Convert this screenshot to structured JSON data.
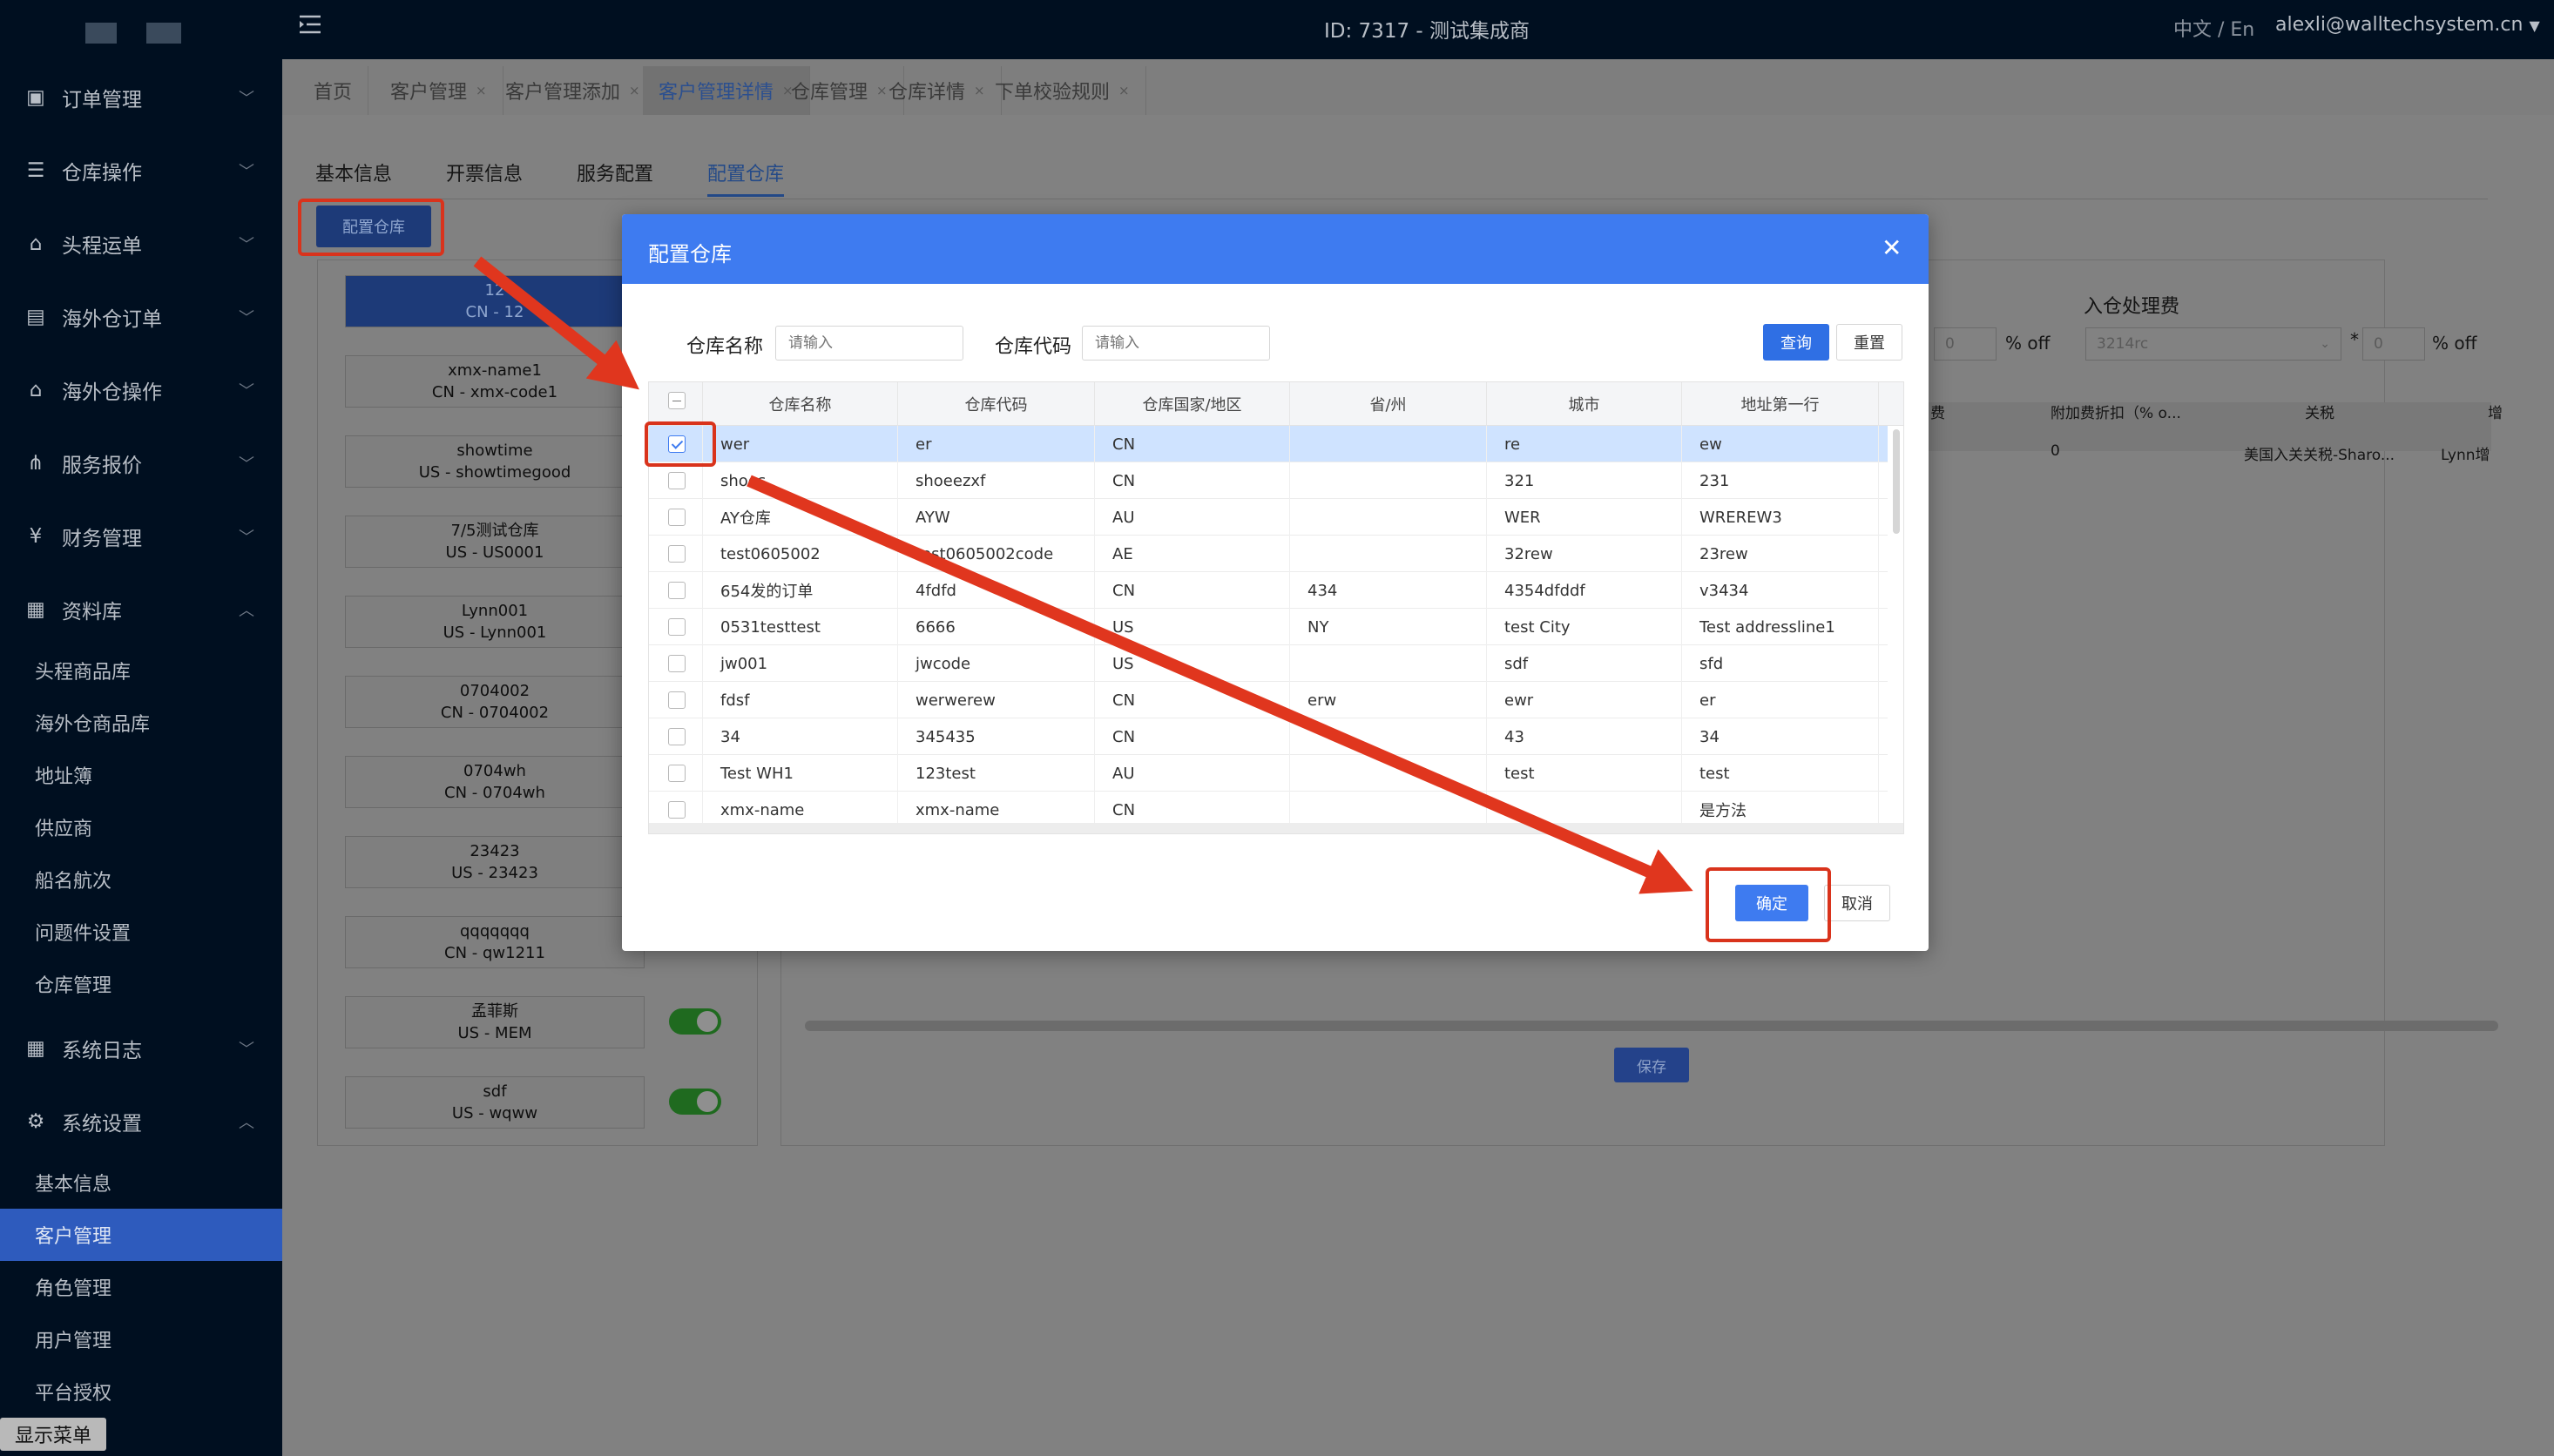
{
  "topbar": {
    "title": "ID: 7317 - 测试集成商",
    "lang": "中文 / En",
    "user": "alexli@walltechsystem.cn"
  },
  "sidebar": {
    "items": [
      {
        "label": "订单管理",
        "icon": "clipboard-icon"
      },
      {
        "label": "仓库操作",
        "icon": "warehouse-icon"
      },
      {
        "label": "头程运单",
        "icon": "package-icon"
      },
      {
        "label": "海外仓订单",
        "icon": "document-icon"
      },
      {
        "label": "海外仓操作",
        "icon": "home-icon"
      },
      {
        "label": "服务报价",
        "icon": "share-icon"
      },
      {
        "label": "财务管理",
        "icon": "yen-icon"
      },
      {
        "label": "资料库",
        "icon": "grid-icon"
      }
    ],
    "resource_sub": [
      "头程商品库",
      "海外仓商品库",
      "地址簿",
      "供应商",
      "船名航次",
      "问题件设置",
      "仓库管理"
    ],
    "log_label": "系统日志",
    "settings_label": "系统设置",
    "settings_sub": [
      "基本信息",
      "客户管理",
      "角色管理",
      "用户管理",
      "平台授权"
    ],
    "show_menu": "显示菜单"
  },
  "tabs": [
    {
      "label": "首页"
    },
    {
      "label": "客户管理"
    },
    {
      "label": "客户管理添加"
    },
    {
      "label": "客户管理详情"
    },
    {
      "label": "仓库管理"
    },
    {
      "label": "仓库详情"
    },
    {
      "label": "下单校验规则"
    }
  ],
  "subtabs": [
    "基本信息",
    "开票信息",
    "服务配置",
    "配置仓库"
  ],
  "config_button": "配置仓库",
  "warehouse_cards": [
    {
      "name": "12",
      "code": "CN - 12"
    },
    {
      "name": "xmx-name1",
      "code": "CN - xmx-code1"
    },
    {
      "name": "showtime",
      "code": "US - showtimegood"
    },
    {
      "name": "7/5测试仓库",
      "code": "US - US0001"
    },
    {
      "name": "Lynn001",
      "code": "US - Lynn001"
    },
    {
      "name": "0704002",
      "code": "CN - 0704002"
    },
    {
      "name": "0704wh",
      "code": "CN - 0704wh"
    },
    {
      "name": "23423",
      "code": "US - 23423"
    },
    {
      "name": "qqqqqqq",
      "code": "CN - qw1211"
    },
    {
      "name": "孟菲斯",
      "code": "US - MEM"
    },
    {
      "name": "sdf",
      "code": "US - wqww"
    }
  ],
  "right_panel": {
    "fee_title": "入仓处理费",
    "discount1": "0",
    "off": "% off",
    "select": "3214rc",
    "star": "*",
    "discount2": "0",
    "headers": [
      "费",
      "附加费折扣（% o...",
      "关税",
      "增"
    ],
    "row": [
      "0",
      "美国入关关税-Sharo...",
      "Lynn增"
    ],
    "save": "保存"
  },
  "modal": {
    "title": "配置仓库",
    "filters": {
      "name_label": "仓库名称",
      "name_placeholder": "请输入",
      "code_label": "仓库代码",
      "code_placeholder": "请输入"
    },
    "query": "查询",
    "reset": "重置",
    "columns": [
      "仓库名称",
      "仓库代码",
      "仓库国家/地区",
      "省/州",
      "城市",
      "地址第一行"
    ],
    "rows": [
      {
        "checked": true,
        "cells": [
          "wer",
          "er",
          "CN",
          "",
          "re",
          "ew"
        ]
      },
      {
        "checked": false,
        "cells": [
          "shoes",
          "shoeezxf",
          "CN",
          "",
          "321",
          "231"
        ]
      },
      {
        "checked": false,
        "cells": [
          "AY仓库",
          "AYW",
          "AU",
          "",
          "WER",
          "WREREW3"
        ]
      },
      {
        "checked": false,
        "cells": [
          "test0605002",
          "test0605002code",
          "AE",
          "",
          "32rew",
          "23rew"
        ]
      },
      {
        "checked": false,
        "cells": [
          "654发的订单",
          "4fdfd",
          "CN",
          "434",
          "4354dfddf",
          "v3434"
        ]
      },
      {
        "checked": false,
        "cells": [
          "0531testtest",
          "6666",
          "US",
          "NY",
          "test City",
          "Test addressline1"
        ]
      },
      {
        "checked": false,
        "cells": [
          "jw001",
          "jwcode",
          "US",
          "",
          "sdf",
          "sfd"
        ]
      },
      {
        "checked": false,
        "cells": [
          "fdsf",
          "werwerew",
          "CN",
          "erw",
          "ewr",
          "er"
        ]
      },
      {
        "checked": false,
        "cells": [
          "34",
          "345435",
          "CN",
          "",
          "43",
          "34"
        ]
      },
      {
        "checked": false,
        "cells": [
          "Test WH1",
          "123test",
          "AU",
          "",
          "test",
          "test"
        ]
      },
      {
        "checked": false,
        "cells": [
          "xmx-name",
          "xmx-name",
          "CN",
          "",
          "",
          "是方法"
        ]
      }
    ],
    "ok": "确定",
    "cancel": "取消"
  },
  "colors": {
    "primary": "#3e7bf0",
    "sidebar": "#000f20",
    "annotation": "#e0361e"
  }
}
